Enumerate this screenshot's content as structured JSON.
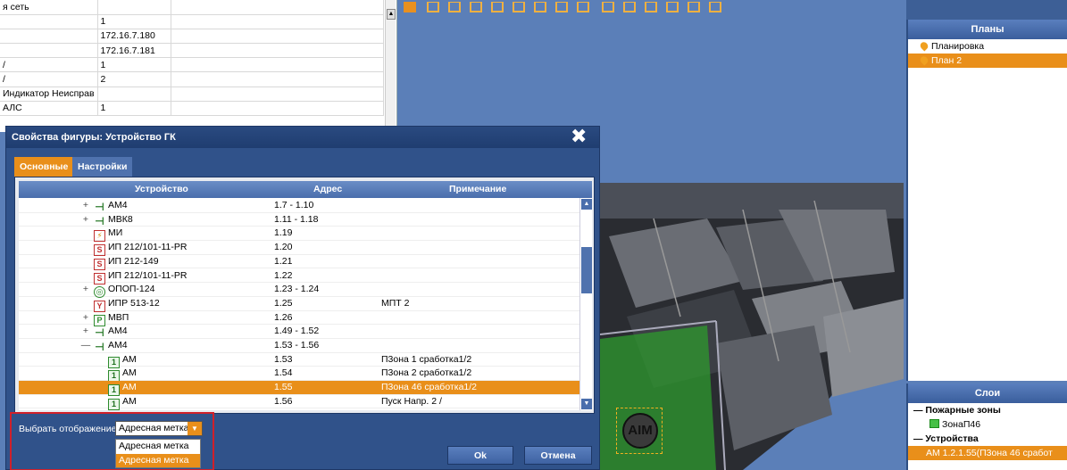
{
  "prop_grid": {
    "rows": [
      {
        "name": "я сеть",
        "value": ""
      },
      {
        "name": "",
        "value": "1"
      },
      {
        "name": "",
        "value": "172.16.7.180"
      },
      {
        "name": "",
        "value": "172.16.7.181"
      },
      {
        "name": "/",
        "value": "1"
      },
      {
        "name": "/",
        "value": "2"
      },
      {
        "name": "Индикатор Неисправ",
        "value": ""
      },
      {
        "name": "АЛС",
        "value": "1"
      }
    ]
  },
  "plans_panel": {
    "header": "Планы",
    "items": [
      {
        "label": "Планировка",
        "selected": false
      },
      {
        "label": "План 2",
        "selected": true
      }
    ]
  },
  "layers_panel": {
    "header": "Слои",
    "fire_zones_group": "— Пожарные зоны",
    "fire_zone_item": "ЗонаП46",
    "devices_group": "— Устройства",
    "device_item": "АМ 1.2.1.55(П3она 46 сработ"
  },
  "map_overlay": {
    "aim_label": "AIM"
  },
  "dialog": {
    "title": "Свойства фигуры: Устройство ГК",
    "close_symbol": "✖",
    "tabs": [
      {
        "label": "Основные",
        "active": true
      },
      {
        "label": "Настройки",
        "active": false
      }
    ],
    "columns": {
      "device": "Устройство",
      "address": "Адрес",
      "note": "Примечание"
    },
    "devices": [
      {
        "ctl": "+",
        "icon": "mvk",
        "glyph": "⊣",
        "name": "АМ4",
        "address": "1.7 - 1.10",
        "note": "",
        "indent": 1
      },
      {
        "ctl": "+",
        "icon": "mvk",
        "glyph": "⊣",
        "name": "МВК8",
        "address": "1.11 - 1.18",
        "note": "",
        "indent": 1
      },
      {
        "ctl": "",
        "icon": "mi",
        "glyph": "⚡",
        "name": "МИ",
        "address": "1.19",
        "note": "",
        "indent": 1
      },
      {
        "ctl": "",
        "icon": "ip",
        "glyph": "S",
        "name": "ИП 212/101-11-PR",
        "address": "1.20",
        "note": "",
        "indent": 1
      },
      {
        "ctl": "",
        "icon": "ip",
        "glyph": "S",
        "name": "ИП 212-149",
        "address": "1.21",
        "note": "",
        "indent": 1
      },
      {
        "ctl": "",
        "icon": "ip",
        "glyph": "S",
        "name": "ИП 212/101-11-PR",
        "address": "1.22",
        "note": "",
        "indent": 1
      },
      {
        "ctl": "+",
        "icon": "opop",
        "glyph": "◎",
        "name": "ОПОП-124",
        "address": "1.23 - 1.24",
        "note": "",
        "indent": 1
      },
      {
        "ctl": "",
        "icon": "ipr",
        "glyph": "Y",
        "name": "ИПР 513-12",
        "address": "1.25",
        "note": "МПТ 2",
        "indent": 1
      },
      {
        "ctl": "+",
        "icon": "mvp",
        "glyph": "P",
        "name": "МВП",
        "address": "1.26",
        "note": "",
        "indent": 1
      },
      {
        "ctl": "+",
        "icon": "mvk",
        "glyph": "⊣",
        "name": "АМ4",
        "address": "1.49 - 1.52",
        "note": "",
        "indent": 1
      },
      {
        "ctl": "—",
        "icon": "mvk",
        "glyph": "⊣",
        "name": "АМ4",
        "address": "1.53 - 1.56",
        "note": "",
        "indent": 1
      },
      {
        "ctl": "",
        "icon": "am",
        "glyph": "1",
        "name": "АМ",
        "address": "1.53",
        "note": "П3она 1 сработка1/2",
        "indent": 2
      },
      {
        "ctl": "",
        "icon": "am",
        "glyph": "1",
        "name": "АМ",
        "address": "1.54",
        "note": "П3она 2 сработка1/2",
        "indent": 2
      },
      {
        "ctl": "",
        "icon": "am",
        "glyph": "1",
        "name": "АМ",
        "address": "1.55",
        "note": "П3она 46 сработка1/2",
        "indent": 2,
        "selected": true
      },
      {
        "ctl": "",
        "icon": "am",
        "glyph": "1",
        "name": "АМ",
        "address": "1.56",
        "note": "Пуск Напр. 2 /",
        "indent": 2
      }
    ],
    "view_label": "Выбрать отображение",
    "view_selected": "Адресная метка",
    "view_options": [
      {
        "label": "Адресная метка",
        "selected": false
      },
      {
        "label": "Адресная метка",
        "selected": true
      }
    ],
    "ok_label": "Ok",
    "cancel_label": "Отмена"
  },
  "colors": {
    "accent": "#e98f1a",
    "dialog_bg": "#30528a",
    "workspace_bg": "#5b7fb8",
    "highlight": "#d0202a"
  }
}
